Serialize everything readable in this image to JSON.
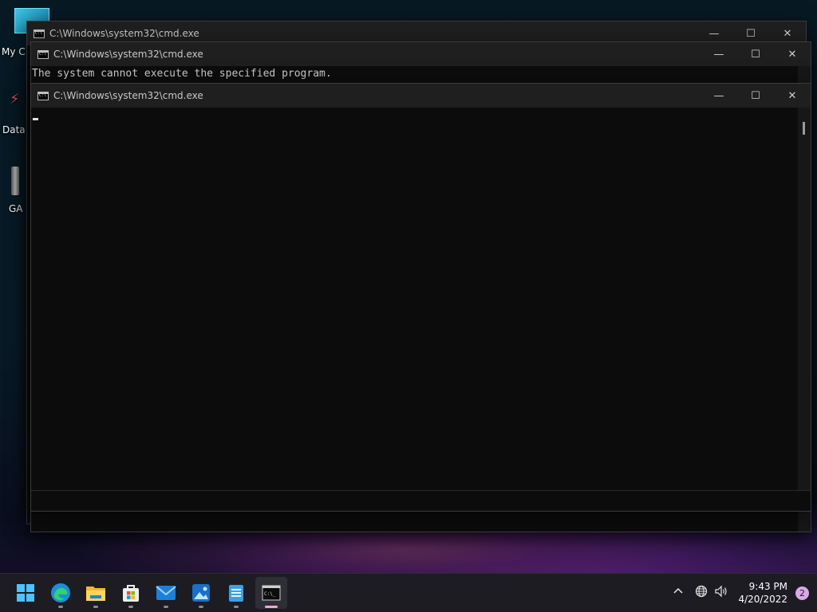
{
  "desktop": {
    "icons": [
      {
        "label": "My C"
      },
      {
        "label": "Data"
      },
      {
        "label": "GA"
      }
    ]
  },
  "windows": [
    {
      "title": "C:\\Windows\\system32\\cmd.exe"
    },
    {
      "title": "C:\\Windows\\system32\\cmd.exe",
      "output": "The system cannot execute the specified program."
    },
    {
      "title": "C:\\Windows\\system32\\cmd.exe",
      "output": ""
    }
  ],
  "window_controls": {
    "minimize": "—",
    "maximize": "☐",
    "close": "✕"
  },
  "taskbar": {
    "apps": [
      {
        "name": "Start",
        "icon": "windows-logo-icon"
      },
      {
        "name": "Microsoft Edge",
        "icon": "edge-icon"
      },
      {
        "name": "File Explorer",
        "icon": "folder-icon"
      },
      {
        "name": "Microsoft Store",
        "icon": "store-icon"
      },
      {
        "name": "Mail",
        "icon": "mail-icon"
      },
      {
        "name": "Photos",
        "icon": "photos-icon"
      },
      {
        "name": "Notepad",
        "icon": "notepad-icon"
      },
      {
        "name": "Command Prompt",
        "icon": "terminal-icon"
      }
    ],
    "tray": {
      "time": "9:43 PM",
      "date": "4/20/2022",
      "notifications": "2"
    }
  }
}
